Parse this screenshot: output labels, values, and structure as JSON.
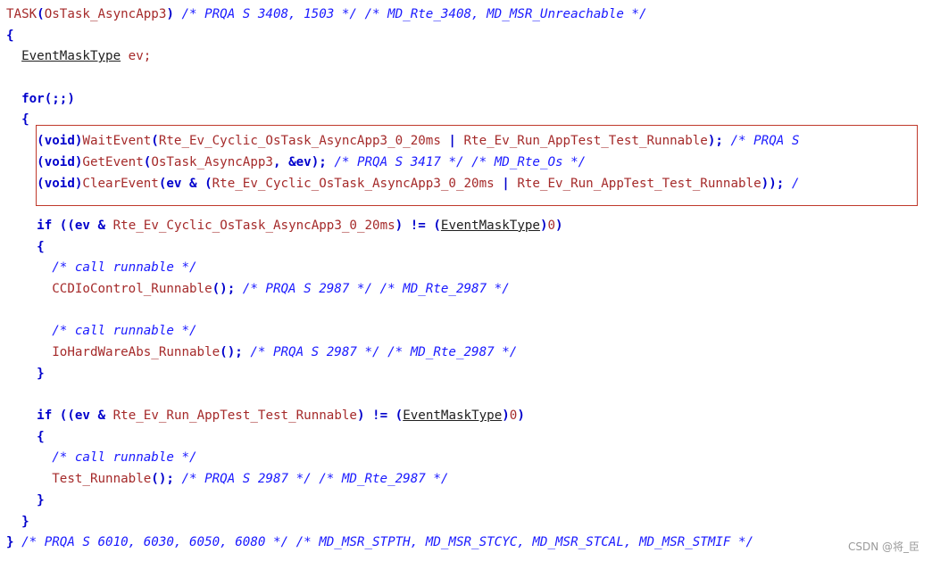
{
  "lines": [
    [
      {
        "t": "TASK",
        "c": "fn"
      },
      {
        "t": "(",
        "c": "pn"
      },
      {
        "t": "OsTask_AsyncApp3",
        "c": "id"
      },
      {
        "t": ")",
        "c": "pn"
      },
      {
        "t": " /* PRQA S 3408, 1503 */ /* MD_Rte_3408, MD_MSR_Unreachable */",
        "c": "cm"
      }
    ],
    [
      {
        "t": "{",
        "c": "pn"
      }
    ],
    [
      {
        "t": "  ",
        "c": "txt"
      },
      {
        "t": "EventMaskType",
        "c": "ty"
      },
      {
        "t": " ev;",
        "c": "txt"
      }
    ],
    [
      {
        "t": "",
        "c": "txt"
      }
    ],
    [
      {
        "t": "  ",
        "c": "txt"
      },
      {
        "t": "for",
        "c": "kw"
      },
      {
        "t": "(;;)",
        "c": "pn"
      }
    ],
    [
      {
        "t": "  {",
        "c": "pn"
      }
    ],
    [
      {
        "t": "    (void)",
        "c": "pn"
      },
      {
        "t": "WaitEvent",
        "c": "fn"
      },
      {
        "t": "(",
        "c": "pn"
      },
      {
        "t": "Rte_Ev_Cyclic_OsTask_AsyncApp3_0_20ms",
        "c": "id"
      },
      {
        "t": " | ",
        "c": "pn"
      },
      {
        "t": "Rte_Ev_Run_AppTest_Test_Runnable",
        "c": "id"
      },
      {
        "t": "); ",
        "c": "pn"
      },
      {
        "t": "/* PRQA S",
        "c": "cm"
      }
    ],
    [
      {
        "t": "    (void)",
        "c": "pn"
      },
      {
        "t": "GetEvent",
        "c": "fn"
      },
      {
        "t": "(",
        "c": "pn"
      },
      {
        "t": "OsTask_AsyncApp3",
        "c": "id"
      },
      {
        "t": ", &ev); ",
        "c": "pn"
      },
      {
        "t": "/* PRQA S 3417 */ /* MD_Rte_Os */",
        "c": "cm"
      }
    ],
    [
      {
        "t": "    (void)",
        "c": "pn"
      },
      {
        "t": "ClearEvent",
        "c": "fn"
      },
      {
        "t": "(ev & (",
        "c": "pn"
      },
      {
        "t": "Rte_Ev_Cyclic_OsTask_AsyncApp3_0_20ms",
        "c": "id"
      },
      {
        "t": " | ",
        "c": "pn"
      },
      {
        "t": "Rte_Ev_Run_AppTest_Test_Runnable",
        "c": "id"
      },
      {
        "t": ")); ",
        "c": "pn"
      },
      {
        "t": "/",
        "c": "cm"
      }
    ],
    [
      {
        "t": "",
        "c": "txt"
      }
    ],
    [
      {
        "t": "    ",
        "c": "txt"
      },
      {
        "t": "if",
        "c": "kw"
      },
      {
        "t": " ((ev & ",
        "c": "pn"
      },
      {
        "t": "Rte_Ev_Cyclic_OsTask_AsyncApp3_0_20ms",
        "c": "id"
      },
      {
        "t": ") != (",
        "c": "pn"
      },
      {
        "t": "EventMaskType",
        "c": "ty"
      },
      {
        "t": ")",
        "c": "pn"
      },
      {
        "t": "0",
        "c": "num"
      },
      {
        "t": ")",
        "c": "pn"
      }
    ],
    [
      {
        "t": "    {",
        "c": "pn"
      }
    ],
    [
      {
        "t": "      ",
        "c": "txt"
      },
      {
        "t": "/* call runnable */",
        "c": "cm"
      }
    ],
    [
      {
        "t": "      ",
        "c": "txt"
      },
      {
        "t": "CCDIoControl_Runnable",
        "c": "fn"
      },
      {
        "t": "(); ",
        "c": "pn"
      },
      {
        "t": "/* PRQA S 2987 */ /* MD_Rte_2987 */",
        "c": "cm"
      }
    ],
    [
      {
        "t": "",
        "c": "txt"
      }
    ],
    [
      {
        "t": "      ",
        "c": "txt"
      },
      {
        "t": "/* call runnable */",
        "c": "cm"
      }
    ],
    [
      {
        "t": "      ",
        "c": "txt"
      },
      {
        "t": "IoHardWareAbs_Runnable",
        "c": "fn"
      },
      {
        "t": "(); ",
        "c": "pn"
      },
      {
        "t": "/* PRQA S 2987 */ /* MD_Rte_2987 */",
        "c": "cm"
      }
    ],
    [
      {
        "t": "    }",
        "c": "pn"
      }
    ],
    [
      {
        "t": "",
        "c": "txt"
      }
    ],
    [
      {
        "t": "    ",
        "c": "txt"
      },
      {
        "t": "if",
        "c": "kw"
      },
      {
        "t": " ((ev & ",
        "c": "pn"
      },
      {
        "t": "Rte_Ev_Run_AppTest_Test_Runnable",
        "c": "id"
      },
      {
        "t": ") != (",
        "c": "pn"
      },
      {
        "t": "EventMaskType",
        "c": "ty"
      },
      {
        "t": ")",
        "c": "pn"
      },
      {
        "t": "0",
        "c": "num"
      },
      {
        "t": ")",
        "c": "pn"
      }
    ],
    [
      {
        "t": "    {",
        "c": "pn"
      }
    ],
    [
      {
        "t": "      ",
        "c": "txt"
      },
      {
        "t": "/* call runnable */",
        "c": "cm"
      }
    ],
    [
      {
        "t": "      ",
        "c": "txt"
      },
      {
        "t": "Test_Runnable",
        "c": "fn"
      },
      {
        "t": "(); ",
        "c": "pn"
      },
      {
        "t": "/* PRQA S 2987 */ /* MD_Rte_2987 */",
        "c": "cm"
      }
    ],
    [
      {
        "t": "    }",
        "c": "pn"
      }
    ],
    [
      {
        "t": "  }",
        "c": "pn"
      }
    ],
    [
      {
        "t": "} ",
        "c": "pn"
      },
      {
        "t": "/* PRQA S 6010, 6030, 6050, 6080 */ /* MD_MSR_STPTH, MD_MSR_STCYC, MD_MSR_STCAL, MD_MSR_STMIF */",
        "c": "cm"
      }
    ]
  ],
  "watermark": "CSDN @将_臣",
  "colors": {
    "keyword": "#0000cc",
    "identifier": "#a52a2a",
    "comment": "#1a1aff",
    "highlight_border": "#c0392b"
  }
}
